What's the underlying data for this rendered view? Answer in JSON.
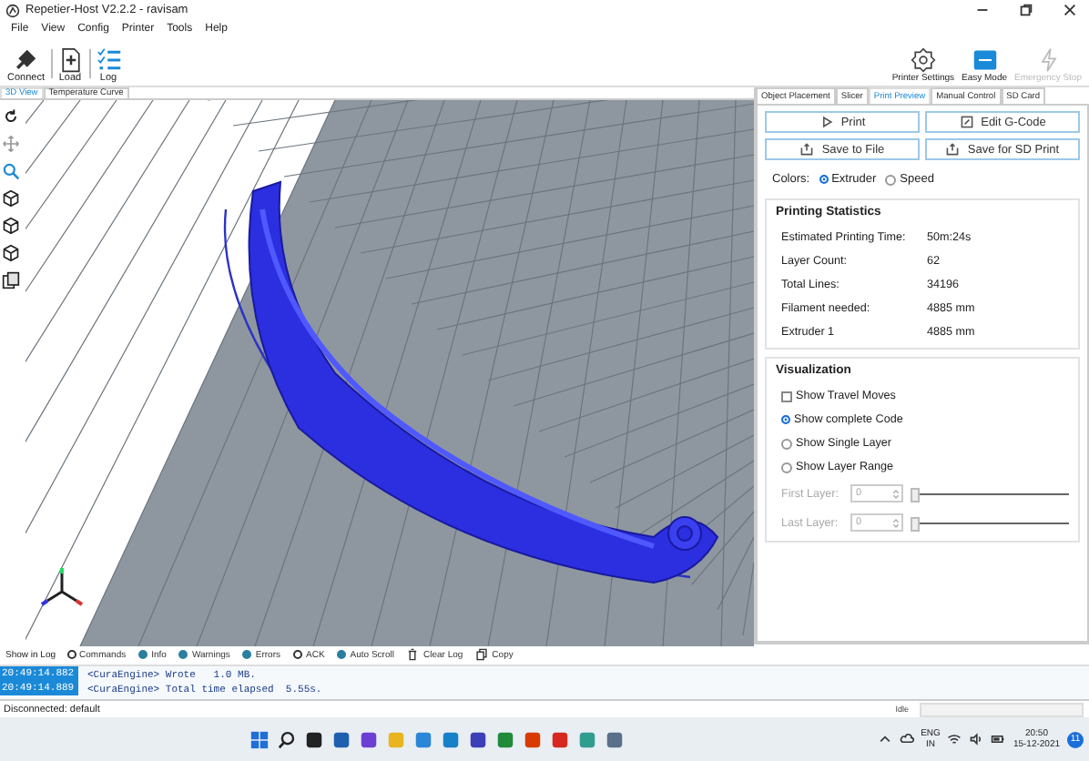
{
  "window": {
    "title": "Repetier-Host V2.2.2 - ravisam"
  },
  "menu": [
    "File",
    "View",
    "Config",
    "Printer",
    "Tools",
    "Help"
  ],
  "toolbar": [
    {
      "label": "Connect",
      "kind": "connect"
    },
    {
      "label": "Load",
      "kind": "load"
    },
    {
      "label": "Log",
      "kind": "log"
    }
  ],
  "toolbar_right": [
    {
      "label": "Printer Settings",
      "kind": "gear",
      "disabled": false
    },
    {
      "label": "Easy Mode",
      "kind": "easy",
      "disabled": false
    },
    {
      "label": "Emergency Stop",
      "kind": "bolt",
      "disabled": true
    }
  ],
  "view_tabs": [
    {
      "label": "3D View",
      "selected": true
    },
    {
      "label": "Temperature Curve",
      "selected": false
    }
  ],
  "panel_tabs": [
    {
      "label": "Object Placement",
      "selected": false
    },
    {
      "label": "Slicer",
      "selected": false
    },
    {
      "label": "Print Preview",
      "selected": true
    },
    {
      "label": "Manual Control",
      "selected": false
    },
    {
      "label": "SD Card",
      "selected": false
    }
  ],
  "actions": [
    {
      "label": "Print",
      "kind": "play"
    },
    {
      "label": "Edit G-Code",
      "kind": "edit"
    },
    {
      "label": "Save to File",
      "kind": "save"
    },
    {
      "label": "Save for SD Print",
      "kind": "save"
    }
  ],
  "colors": {
    "label": "Colors:",
    "options": [
      {
        "label": "Extruder",
        "selected": true
      },
      {
        "label": "Speed",
        "selected": false
      }
    ]
  },
  "statistics": {
    "title": "Printing Statistics",
    "rows": [
      {
        "label": "Estimated Printing Time:",
        "value": "50m:24s"
      },
      {
        "label": "Layer Count:",
        "value": "62"
      },
      {
        "label": "Total Lines:",
        "value": "34196"
      },
      {
        "label": "Filament needed:",
        "value": "4885 mm"
      },
      {
        "label": "Extruder 1",
        "value": "4885 mm"
      }
    ]
  },
  "visualization": {
    "title": "Visualization",
    "options": [
      {
        "kind": "checkbox",
        "label": "Show Travel Moves",
        "checked": false
      },
      {
        "kind": "radio",
        "label": "Show complete Code",
        "checked": true
      },
      {
        "kind": "radio",
        "label": "Show Single Layer",
        "checked": false
      },
      {
        "kind": "radio",
        "label": "Show Layer Range",
        "checked": false
      }
    ],
    "layers": [
      {
        "label": "First Layer:",
        "value": "0",
        "disabled": true
      },
      {
        "label": "Last Layer:",
        "value": "0",
        "disabled": true
      }
    ]
  },
  "log_bar": {
    "label": "Show in Log",
    "items": [
      {
        "kind": "toggle",
        "label": "Commands",
        "on": false
      },
      {
        "kind": "toggle",
        "label": "Info",
        "on": true
      },
      {
        "kind": "toggle",
        "label": "Warnings",
        "on": true
      },
      {
        "kind": "toggle",
        "label": "Errors",
        "on": true
      },
      {
        "kind": "toggle",
        "label": "ACK",
        "on": false
      },
      {
        "kind": "toggle",
        "label": "Auto Scroll",
        "on": true
      },
      {
        "kind": "clear",
        "label": "Clear Log"
      },
      {
        "kind": "copy",
        "label": "Copy"
      }
    ]
  },
  "log": [
    {
      "time": "20:49:14.882",
      "message": "<CuraEngine> Wrote   1.0 MB."
    },
    {
      "time": "20:49:14.889",
      "message": "<CuraEngine> Total time elapsed  5.55s."
    }
  ],
  "status_bar": {
    "connection": "Disconnected: default",
    "state": "Idle",
    "progress": {
      "level": 0
    }
  },
  "taskbar": {
    "language": "ENG",
    "region": "IN",
    "time": "20:50",
    "date": "15-12-2021",
    "notifications": "11"
  }
}
